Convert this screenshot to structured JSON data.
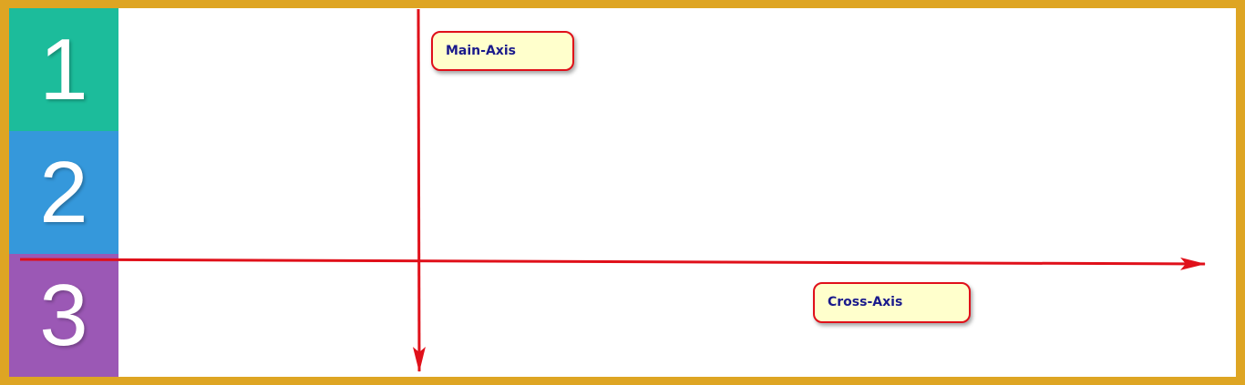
{
  "colors": {
    "frame": "#dea523",
    "box_1": "#1cbc9b",
    "box_2": "#3598db",
    "box_3": "#9b58b5",
    "arrow": "#e0101a",
    "callout_fill": "#ffffcc",
    "callout_text": "#1a1a8c"
  },
  "boxes": [
    {
      "label": "1"
    },
    {
      "label": "2"
    },
    {
      "label": "3"
    }
  ],
  "callouts": {
    "main_axis": "Main-Axis",
    "cross_axis": "Cross-Axis"
  },
  "arrows": {
    "main_axis_direction": "down",
    "cross_axis_direction": "right"
  }
}
